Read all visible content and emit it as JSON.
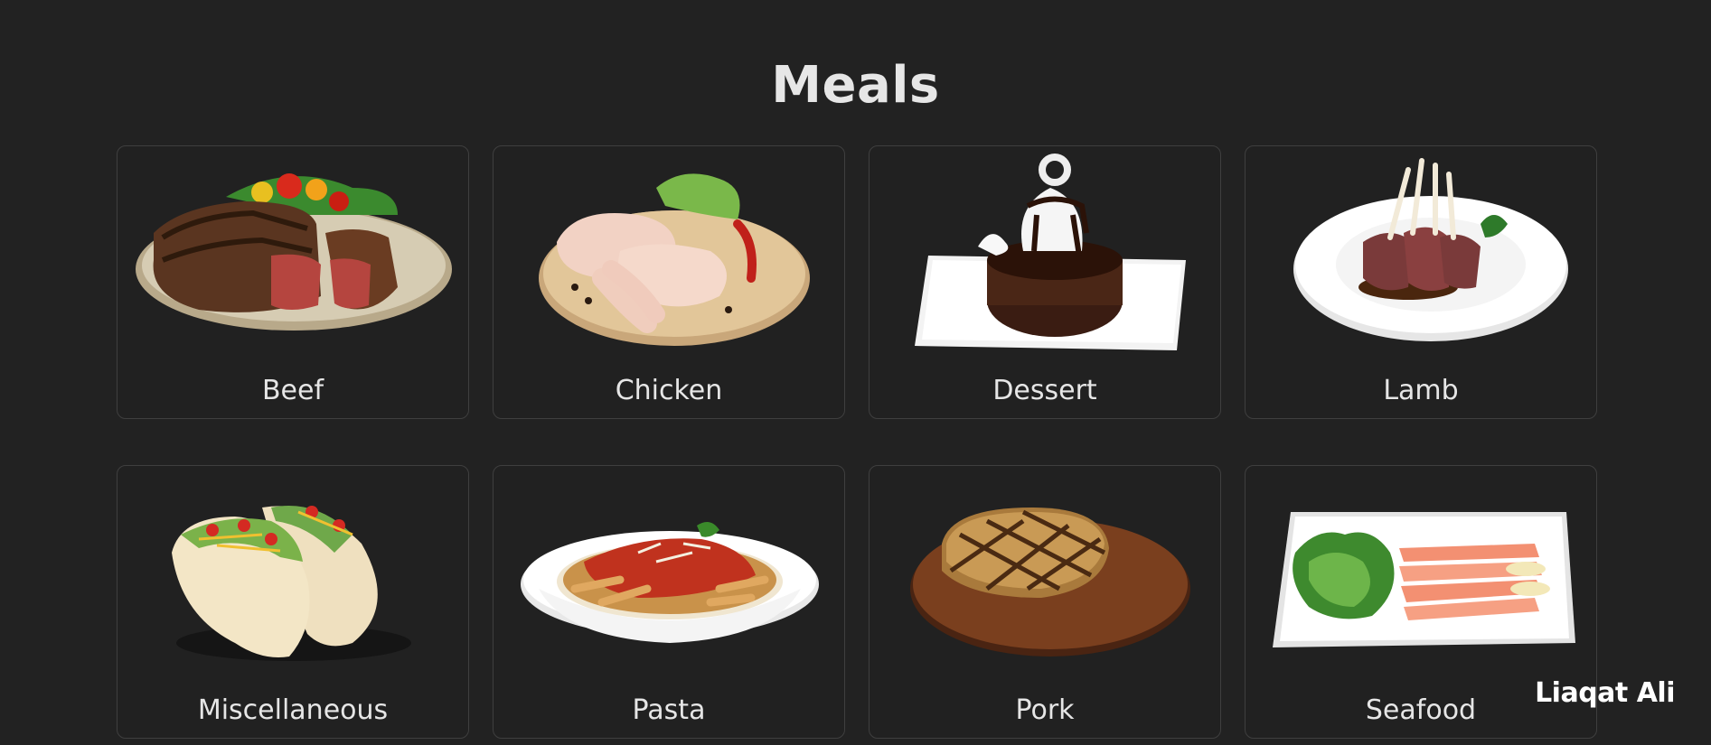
{
  "page": {
    "title": "Meals",
    "watermark": "Liaqat Ali"
  },
  "categories": [
    {
      "label": "Beef",
      "image": "beef-steak-plate"
    },
    {
      "label": "Chicken",
      "image": "raw-chicken-board"
    },
    {
      "label": "Dessert",
      "image": "chocolate-cake-plate"
    },
    {
      "label": "Lamb",
      "image": "lamb-rack-plate"
    },
    {
      "label": "Miscellaneous",
      "image": "tacos"
    },
    {
      "label": "Pasta",
      "image": "penne-bowl"
    },
    {
      "label": "Pork",
      "image": "pork-chop-board"
    },
    {
      "label": "Seafood",
      "image": "salmon-plate"
    }
  ],
  "colors": {
    "background": "#222222",
    "card_border": "#3f3f3f",
    "text": "#e6e6e6"
  }
}
